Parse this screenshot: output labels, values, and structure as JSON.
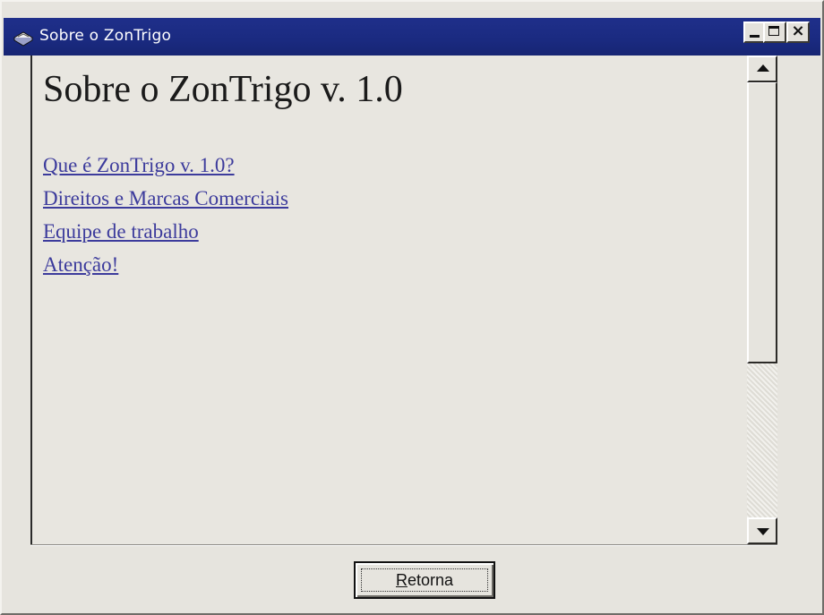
{
  "window": {
    "title": "Sobre o ZonTrigo",
    "icon": "book-icon",
    "controls": {
      "minimize": "minimize-icon",
      "maximize": "maximize-icon",
      "close_glyph": "×"
    }
  },
  "content": {
    "heading": "Sobre o ZonTrigo v. 1.0",
    "links": [
      {
        "label": "Que é ZonTrigo v. 1.0?"
      },
      {
        "label": "Direitos e Marcas Comerciais"
      },
      {
        "label": "Equipe de trabalho"
      },
      {
        "label": "Atenção!"
      }
    ],
    "link_color": "#3c3b9c"
  },
  "footer": {
    "return_button": {
      "accelerator": "R",
      "rest": "etorna"
    }
  },
  "colors": {
    "titlebar": "#1f2f8a",
    "window_bg": "#e6e4de"
  }
}
